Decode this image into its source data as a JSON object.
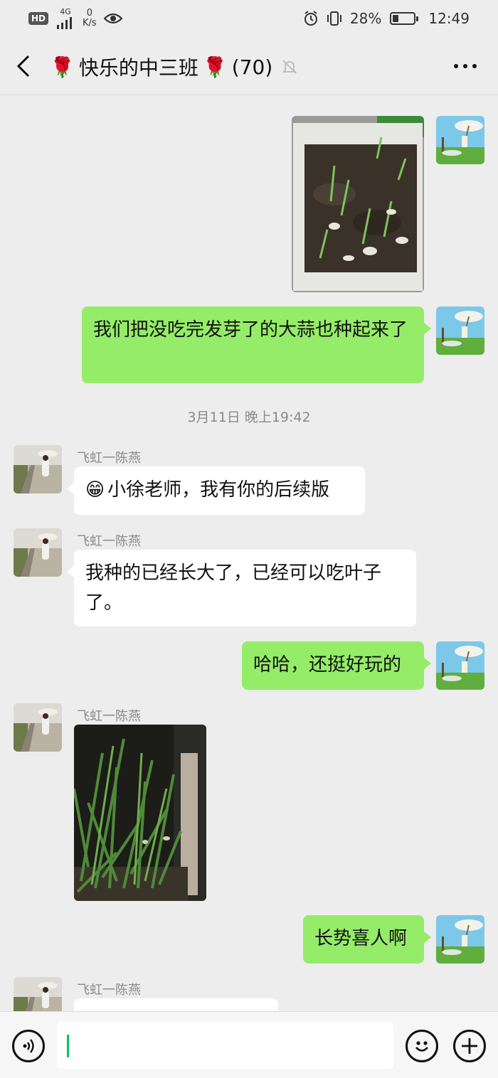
{
  "status_bar": {
    "hd": "HD",
    "network": "4G",
    "speed_value": "0",
    "speed_unit": "K/s",
    "battery_percent": "28%",
    "battery_level": 0.28,
    "time": "12:49"
  },
  "header": {
    "title": "快乐的中三班",
    "member_count": "(70)",
    "rose": "🌹"
  },
  "messages": [
    {
      "id": 1,
      "side": "right",
      "type": "image",
      "image_desc": "garlic-sprouts-in-foam-box"
    },
    {
      "id": 2,
      "side": "right",
      "type": "text",
      "text": "我们把没吃完发芽了的大蒜也种起来了"
    },
    {
      "id": 3,
      "type": "timestamp",
      "text": "3月11日 晚上19:42"
    },
    {
      "id": 4,
      "side": "left",
      "type": "text",
      "sender": "飞虹一陈燕",
      "emoji": "😁",
      "text": "小徐老师，我有你的后续版"
    },
    {
      "id": 5,
      "side": "left",
      "type": "text",
      "sender": "飞虹一陈燕",
      "text": "我种的已经长大了，已经可以吃叶子了。"
    },
    {
      "id": 6,
      "side": "right",
      "type": "text",
      "text": "哈哈，还挺好玩的"
    },
    {
      "id": 7,
      "side": "left",
      "type": "image",
      "sender": "飞虹一陈燕",
      "image_desc": "grown-garlic-leaves-in-planter"
    },
    {
      "id": 8,
      "side": "right",
      "type": "text",
      "text": "长势喜人啊"
    },
    {
      "id": 9,
      "side": "left",
      "type": "text",
      "sender": "飞虹一陈燕",
      "text": ""
    }
  ],
  "input": {
    "value": ""
  },
  "icons": {
    "back": "chevron-left-icon",
    "mute": "bell-off-icon",
    "more": "more-dots-icon",
    "voice": "voice-icon",
    "emoji": "emoji-icon",
    "plus": "plus-icon"
  },
  "colors": {
    "background": "#ededed",
    "my_bubble": "#95ec69",
    "their_bubble": "#ffffff",
    "caret": "#07c160"
  }
}
